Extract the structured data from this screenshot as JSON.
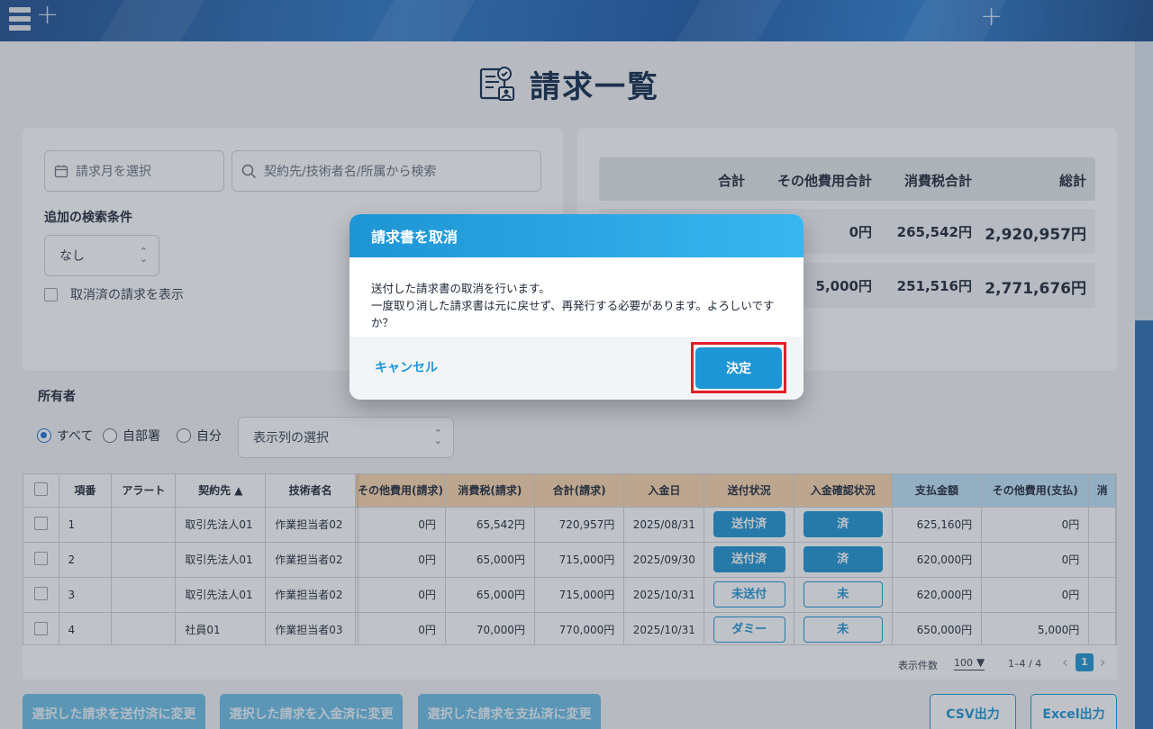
{
  "page": {
    "title": "請求一覧",
    "colors": {
      "accent": "#1e95d4",
      "header_dark": "#1f4f8f",
      "highlight": "#e11d2a"
    }
  },
  "search": {
    "month_placeholder": "請求月を選択",
    "keyword_placeholder": "契約先/技術者名/所属から検索",
    "additional_label": "追加の検索条件",
    "additional_value": "なし",
    "show_cancelled_label": "取消済の請求を表示"
  },
  "totals": {
    "headers": [
      "合計",
      "その他費用合計",
      "消費税合計",
      "総計"
    ],
    "rows": [
      {
        "other": "0円",
        "tax": "265,542円",
        "grand": "2,920,957円"
      },
      {
        "other": "5,000円",
        "tax": "251,516円",
        "grand": "2,771,676円"
      }
    ]
  },
  "owner": {
    "label": "所有者",
    "options": [
      "すべて",
      "自部署",
      "自分"
    ],
    "selected": "すべて",
    "column_select": "表示列の選択"
  },
  "table": {
    "headers": {
      "no": "項番",
      "alert": "アラート",
      "contractor": "契約先 ▲",
      "engineer": "技術者名",
      "other_req": "その他費用(請求)",
      "tax_req": "消費税(請求)",
      "total_req": "合計(請求)",
      "pay_date": "入金日",
      "send_status": "送付状況",
      "pay_confirm": "入金確認状況",
      "payment": "支払金額",
      "other_pay": "その他費用(支払)",
      "extra": "消"
    },
    "rows": [
      {
        "no": "1",
        "contractor": "取引先法人01",
        "engineer": "作業担当者02",
        "other_req": "0円",
        "tax_req": "65,542円",
        "total_req": "720,957円",
        "pay_date": "2025/08/31",
        "send_status": "送付済",
        "pay_confirm": "済",
        "payment": "625,160円",
        "other_pay": "0円"
      },
      {
        "no": "2",
        "contractor": "取引先法人01",
        "engineer": "作業担当者02",
        "other_req": "0円",
        "tax_req": "65,000円",
        "total_req": "715,000円",
        "pay_date": "2025/09/30",
        "send_status": "送付済",
        "pay_confirm": "済",
        "payment": "620,000円",
        "other_pay": "0円"
      },
      {
        "no": "3",
        "contractor": "取引先法人01",
        "engineer": "作業担当者02",
        "other_req": "0円",
        "tax_req": "65,000円",
        "total_req": "715,000円",
        "pay_date": "2025/10/31",
        "send_status": "未送付",
        "pay_confirm": "未",
        "payment": "620,000円",
        "other_pay": "0円"
      },
      {
        "no": "4",
        "contractor": "社員01",
        "engineer": "作業担当者03",
        "other_req": "0円",
        "tax_req": "70,000円",
        "total_req": "770,000円",
        "pay_date": "2025/10/31",
        "send_status": "ダミー",
        "pay_confirm": "未",
        "payment": "650,000円",
        "other_pay": "5,000円"
      }
    ]
  },
  "pager": {
    "per_page_label": "表示件数",
    "per_page_value": "100",
    "range": "1–4 / 4",
    "current_page": "1"
  },
  "actions": {
    "mark_sent": "選択した請求を送付済に変更",
    "mark_paid_in": "選択した請求を入金済に変更",
    "mark_paid_out": "選択した請求を支払済に変更",
    "csv": "CSV出力",
    "excel": "Excel出力"
  },
  "modal": {
    "title": "請求書を取消",
    "line1": "送付した請求書の取消を行います。",
    "line2": "一度取り消した請求書は元に戻せず、再発行する必要があります。よろしいですか？",
    "cancel": "キャンセル",
    "confirm": "決定"
  }
}
